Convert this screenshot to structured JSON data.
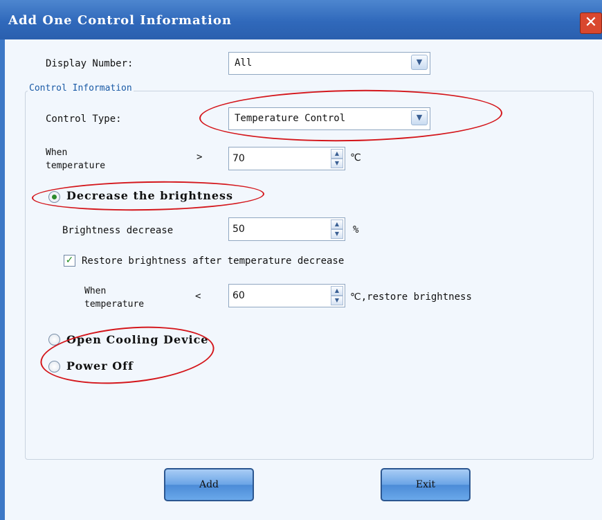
{
  "window": {
    "title": "Add One Control Information",
    "close_glyph": "✕"
  },
  "display_number": {
    "label": "Display Number:",
    "value": "All"
  },
  "group": {
    "legend": "Control Information"
  },
  "control_type": {
    "label": "Control Type:",
    "value": "Temperature Control"
  },
  "temp_rule": {
    "label_line1": "When",
    "label_line2": "temperature",
    "operator": ">",
    "value": "70",
    "unit": "℃"
  },
  "decrease": {
    "label": "Decrease the brightness",
    "selected": true
  },
  "brightness": {
    "label": "Brightness decrease",
    "value": "50",
    "unit": "%"
  },
  "restore": {
    "label": "Restore brightness after temperature decrease",
    "checked": true
  },
  "restore_rule": {
    "label_line1": "When",
    "label_line2": "temperature",
    "operator": "<",
    "value": "60",
    "unit": "℃,restore brightness"
  },
  "cooling": {
    "label": "Open Cooling Device",
    "selected": false
  },
  "power_off": {
    "label": "Power Off",
    "selected": false
  },
  "buttons": {
    "add": "Add",
    "exit": "Exit"
  },
  "icons": {
    "dropdown": "chevron-down-icon",
    "spin_up": "spin-up-icon",
    "spin_down": "spin-down-icon",
    "check": "checkmark-icon"
  },
  "colors": {
    "titlebar": "#3069bb",
    "close": "#d9472e",
    "annotation": "#d4161b",
    "dialog_bg": "#f2f7fd"
  }
}
